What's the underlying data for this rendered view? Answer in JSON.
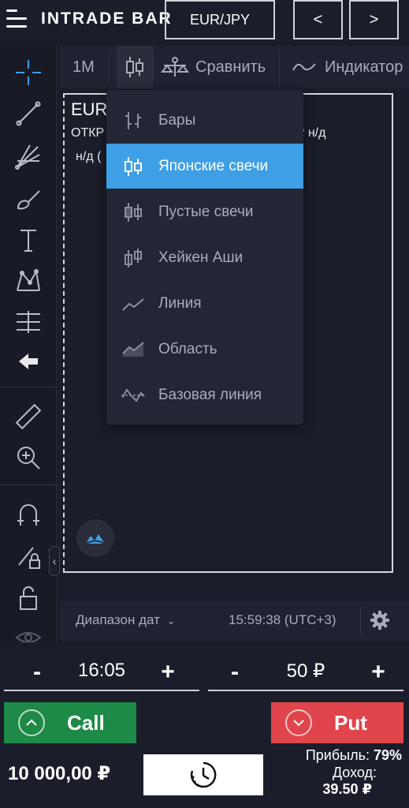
{
  "header": {
    "logo_text": "INTRADE BAR",
    "pair": "EUR/JPY",
    "prev_label": "<",
    "next_label": ">"
  },
  "chart_toolbar": {
    "interval": "1M",
    "compare_label": "Сравнить",
    "indicators_label": "Индикатор"
  },
  "chart": {
    "legend_symbol": "EUR",
    "legend_open": "ОТКР",
    "legend_right": "P н/д",
    "legend_second": "н/д ("
  },
  "chart_type_menu": {
    "items": [
      {
        "label": "Бары",
        "icon": "bars-icon"
      },
      {
        "label": "Японские свечи",
        "icon": "candles-icon",
        "active": true
      },
      {
        "label": "Пустые свечи",
        "icon": "hollow-candles-icon"
      },
      {
        "label": "Хейкен Аши",
        "icon": "heikin-ashi-icon"
      },
      {
        "label": "Линия",
        "icon": "line-icon"
      },
      {
        "label": "Область",
        "icon": "area-icon"
      },
      {
        "label": "Базовая линия",
        "icon": "baseline-icon"
      }
    ]
  },
  "chart_footer": {
    "date_range_label": "Диапазон дат",
    "time": "15:59:38 (UTC+3)"
  },
  "trade": {
    "time_value": "16:05",
    "amount_value": "50 ₽",
    "minus": "-",
    "plus": "+",
    "call_label": "Call",
    "put_label": "Put",
    "balance": "10 000,00 ₽",
    "profit_label": "Прибыль:",
    "profit_value": "79%",
    "income_label": "Доход:",
    "income_value": "39.50 ₽"
  },
  "colors": {
    "background": "#1b1e2a",
    "accent_blue": "#3f9fe5",
    "call_green": "#1e8a47",
    "put_red": "#e0454b"
  }
}
